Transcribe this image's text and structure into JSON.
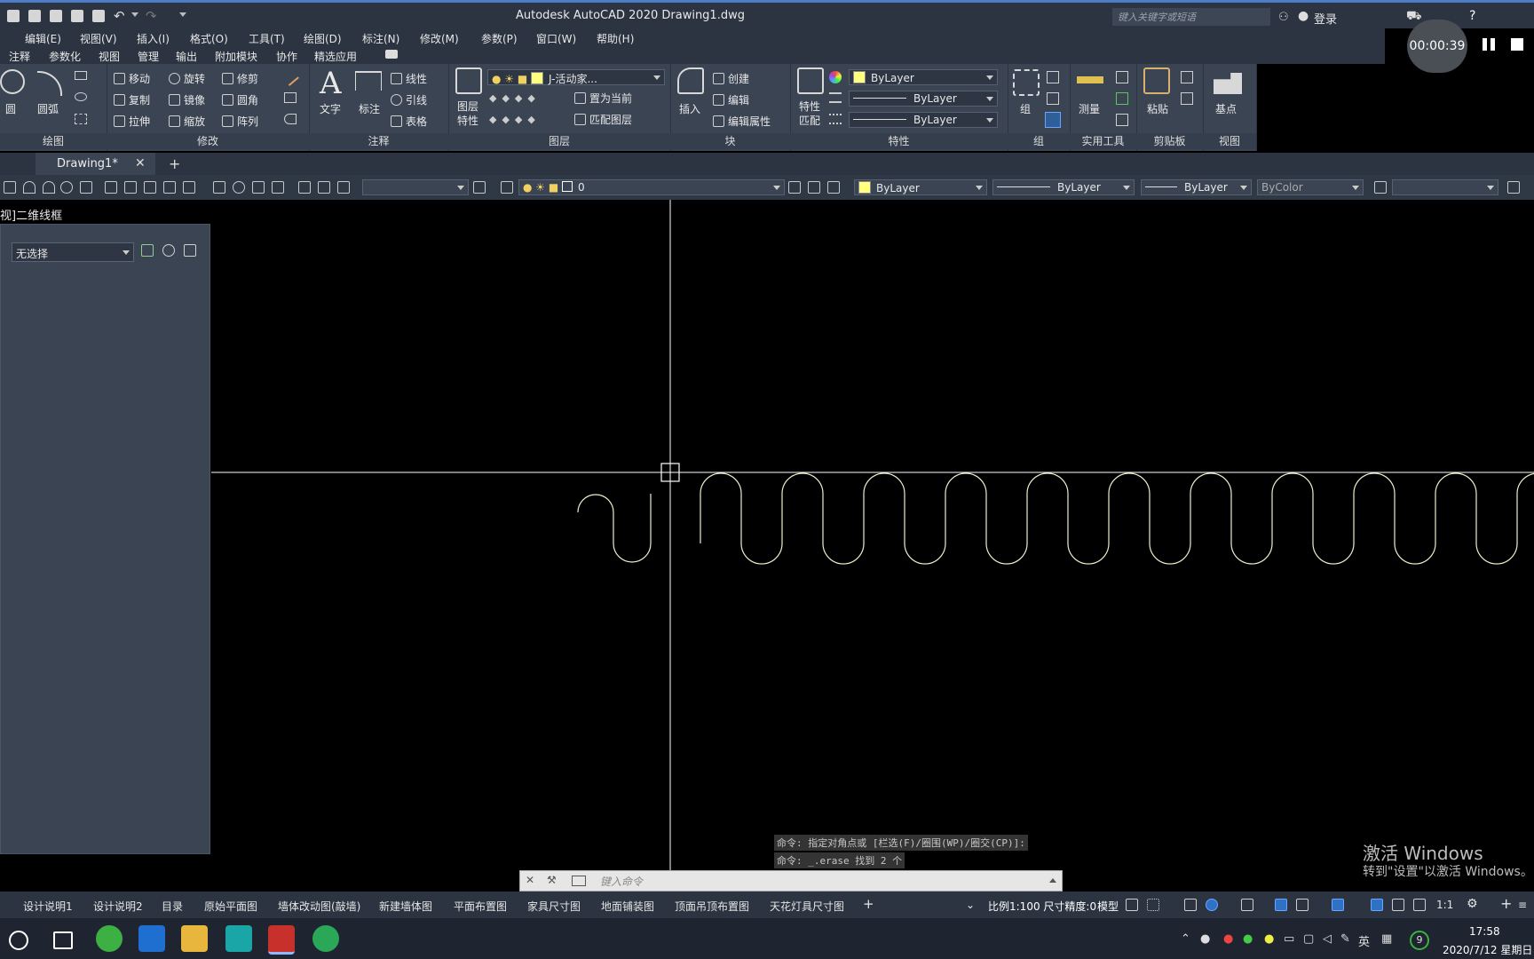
{
  "window": {
    "title": "Autodesk AutoCAD 2020    Drawing1.dwg"
  },
  "search": {
    "placeholder": "键入关键字或短语"
  },
  "account": {
    "login": "登录"
  },
  "recording": {
    "timer": "00:00:39"
  },
  "menubar": [
    "编辑(E)",
    "视图(V)",
    "插入(I)",
    "格式(O)",
    "工具(T)",
    "绘图(D)",
    "标注(N)",
    "修改(M)",
    "参数(P)",
    "窗口(W)",
    "帮助(H)"
  ],
  "ribbon_tabs": [
    "注释",
    "参数化",
    "视图",
    "管理",
    "输出",
    "附加模块",
    "协作",
    "精选应用"
  ],
  "ribbon": {
    "draw": {
      "title": "绘图",
      "circle": "圆",
      "arc": "圆弧"
    },
    "modify": {
      "title": "修改",
      "move": "移动",
      "rotate": "旋转",
      "trim": "修剪",
      "copy": "复制",
      "mirror": "镜像",
      "fillet": "圆角",
      "stretch": "拉伸",
      "scale": "缩放",
      "array": "阵列"
    },
    "annotation": {
      "title": "注释",
      "text": "文字",
      "dimension": "标注",
      "linear": "线性",
      "leader": "引线",
      "table": "表格"
    },
    "layers": {
      "title": "图层",
      "layer_props": "图层\n特性",
      "layer_combo": "J-活动家...",
      "make_current": "置为当前",
      "match_layer": "匹配图层"
    },
    "block": {
      "title": "块",
      "insert": "插入",
      "create": "创建",
      "edit": "编辑",
      "edit_attr": "编辑属性"
    },
    "properties": {
      "title": "特性",
      "match": "特性\n匹配",
      "color": "ByLayer",
      "linetype": "ByLayer",
      "lineweight": "ByLayer"
    },
    "groups": {
      "title": "组",
      "group": "组"
    },
    "utilities": {
      "title": "实用工具",
      "measure": "测量"
    },
    "clipboard": {
      "title": "剪贴板",
      "paste": "粘贴"
    },
    "view": {
      "title": "视图",
      "base": "基点"
    }
  },
  "file_tab": {
    "name": "Drawing1*",
    "close": "✕",
    "new": "+"
  },
  "toolbar2": {
    "layer_value": "0",
    "color": "ByLayer",
    "linetype": "ByLayer",
    "lineweight": "ByLayer",
    "plotstyle": "ByColor"
  },
  "viewport": {
    "label": "视]二维线框"
  },
  "properties_panel": {
    "selection": "无选择"
  },
  "command": {
    "history1": "命令: 指定对角点或 [栏选(F)/圈围(WP)/圈交(CP)]:",
    "history2": "命令: _.erase 找到 2 个",
    "placeholder": "键入命令"
  },
  "watermark": {
    "line1": "激活 Windows",
    "line2": "转到\"设置\"以激活 Windows。"
  },
  "layout_tabs": [
    "设计说明1",
    "设计说明2",
    "目录",
    "原始平面图",
    "墙体改动图(敲墙)",
    "新建墙体图",
    "平面布置图",
    "家具尺寸图",
    "地面铺装图",
    "顶面吊顶布置图",
    "天花灯具尺寸图"
  ],
  "status": {
    "scale": "比例1:100 尺寸精度:0",
    "model": "模型",
    "annoscale": "1:1"
  },
  "taskbar": {
    "time": "17:58",
    "date": "2020/7/12 星期日",
    "ime": "英",
    "badge": "9"
  },
  "colors": {
    "accent": "#4a7cc7",
    "ribbon_bg": "#3b4453",
    "canvas": "#000000",
    "curve": "#f0ecd0"
  }
}
